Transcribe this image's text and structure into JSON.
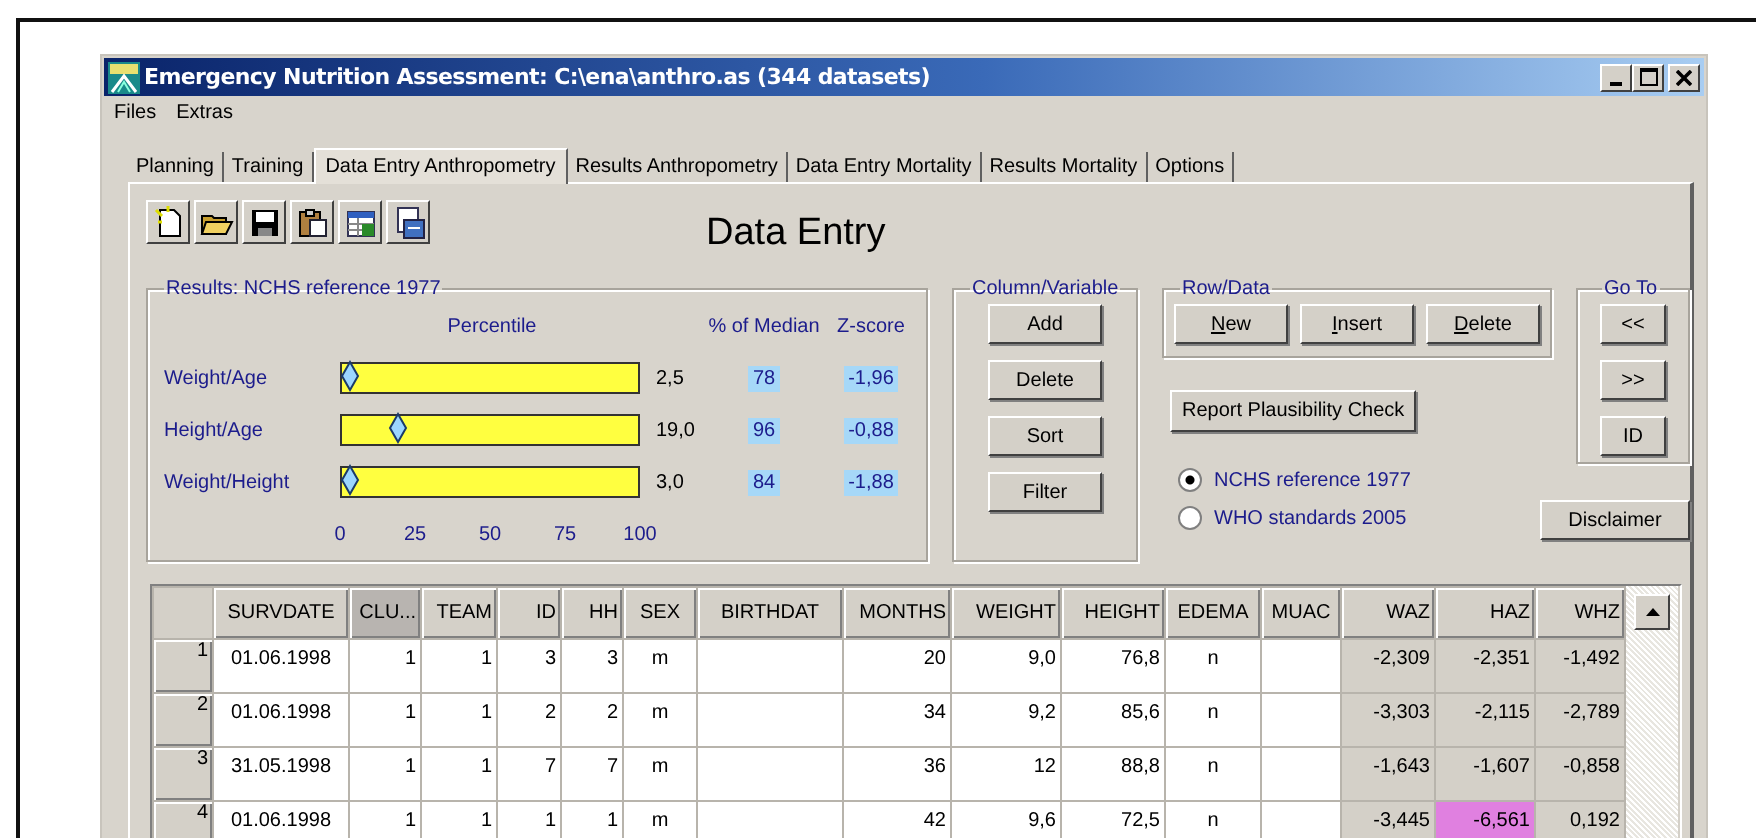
{
  "window": {
    "title": "Emergency Nutrition Assessment: C:\\ena\\anthro.as (344 datasets)"
  },
  "menu": [
    "Files",
    "Extras"
  ],
  "tabs": [
    {
      "label": "Planning",
      "selected": false
    },
    {
      "label": "Training",
      "selected": false
    },
    {
      "label": "Data Entry Anthropometry",
      "selected": true
    },
    {
      "label": "Results Anthropometry",
      "selected": false
    },
    {
      "label": "Data Entry Mortality",
      "selected": false
    },
    {
      "label": "Results Mortality",
      "selected": false
    },
    {
      "label": "Options",
      "selected": false
    }
  ],
  "heading": "Data Entry",
  "results": {
    "title": "Results: NCHS reference 1977",
    "percentile_header": "Percentile",
    "median_header": "% of Median",
    "zscore_header": "Z-score",
    "rows": [
      {
        "label": "Weight/Age",
        "level": 0.025,
        "percentile": "2,5",
        "median": "78",
        "zscore": "-1,96"
      },
      {
        "label": "Height/Age",
        "level": 0.19,
        "percentile": "19,0",
        "median": "96",
        "zscore": "-0,88"
      },
      {
        "label": "Weight/Height",
        "level": 0.03,
        "percentile": "3,0",
        "median": "84",
        "zscore": "-1,88"
      }
    ],
    "ticks": [
      "0",
      "25",
      "50",
      "75",
      "100"
    ]
  },
  "column_variable": {
    "title": "Column/Variable",
    "buttons": [
      "Add",
      "Delete",
      "Sort",
      "Filter"
    ]
  },
  "row_data": {
    "title": "Row/Data",
    "buttons": [
      {
        "label": "New",
        "underline_first": true
      },
      {
        "label": "Insert",
        "underline_first": true
      },
      {
        "label": "Delete",
        "underline_first": true
      }
    ]
  },
  "report_button": "Report Plausibility Check",
  "reference": [
    {
      "label": "NCHS reference 1977",
      "selected": true
    },
    {
      "label": "WHO standards 2005",
      "selected": false
    }
  ],
  "go_to": {
    "title": "Go To",
    "buttons": [
      "<<",
      ">>",
      "ID"
    ]
  },
  "disclaimer_button": "Disclaimer",
  "grid": {
    "columns": [
      {
        "label": "SURVDATE",
        "selected": false
      },
      {
        "label": "CLU...",
        "selected": true
      },
      {
        "label": "TEAM",
        "selected": false
      },
      {
        "label": "ID",
        "selected": false
      },
      {
        "label": "HH",
        "selected": false
      },
      {
        "label": "SEX",
        "selected": false
      },
      {
        "label": "BIRTHDAT",
        "selected": false
      },
      {
        "label": "MONTHS",
        "selected": false
      },
      {
        "label": "WEIGHT",
        "selected": false
      },
      {
        "label": "HEIGHT",
        "selected": false
      },
      {
        "label": "EDEMA",
        "selected": false
      },
      {
        "label": "MUAC",
        "selected": false
      }
    ],
    "z_columns": [
      {
        "label": "WAZ",
        "selected": false
      },
      {
        "label": "HAZ",
        "selected": false
      },
      {
        "label": "WHZ",
        "selected": false
      }
    ],
    "rows": [
      {
        "number": "1",
        "cells": [
          "01.06.1998",
          "1",
          "1",
          "3",
          "3",
          "m",
          "",
          "20",
          "9,0",
          "76,8",
          "n",
          ""
        ],
        "z_scores": [
          {
            "value": "-2,309",
            "flagged": false
          },
          {
            "value": "-2,351",
            "flagged": false
          },
          {
            "value": "-1,492",
            "flagged": false
          }
        ]
      },
      {
        "number": "2",
        "cells": [
          "01.06.1998",
          "1",
          "1",
          "2",
          "2",
          "m",
          "",
          "34",
          "9,2",
          "85,6",
          "n",
          ""
        ],
        "z_scores": [
          {
            "value": "-3,303",
            "flagged": false
          },
          {
            "value": "-2,115",
            "flagged": false
          },
          {
            "value": "-2,789",
            "flagged": false
          }
        ]
      },
      {
        "number": "3",
        "cells": [
          "31.05.1998",
          "1",
          "1",
          "7",
          "7",
          "m",
          "",
          "36",
          "12",
          "88,8",
          "n",
          ""
        ],
        "z_scores": [
          {
            "value": "-1,643",
            "flagged": false
          },
          {
            "value": "-1,607",
            "flagged": false
          },
          {
            "value": "-0,858",
            "flagged": false
          }
        ]
      },
      {
        "number": "4",
        "cells": [
          "01.06.1998",
          "1",
          "1",
          "1",
          "1",
          "m",
          "",
          "42",
          "9,6",
          "72,5",
          "n",
          ""
        ],
        "z_scores": [
          {
            "value": "-3,445",
            "flagged": false
          },
          {
            "value": "-6,561",
            "flagged": true
          },
          {
            "value": "0,192",
            "flagged": false
          }
        ]
      }
    ]
  }
}
